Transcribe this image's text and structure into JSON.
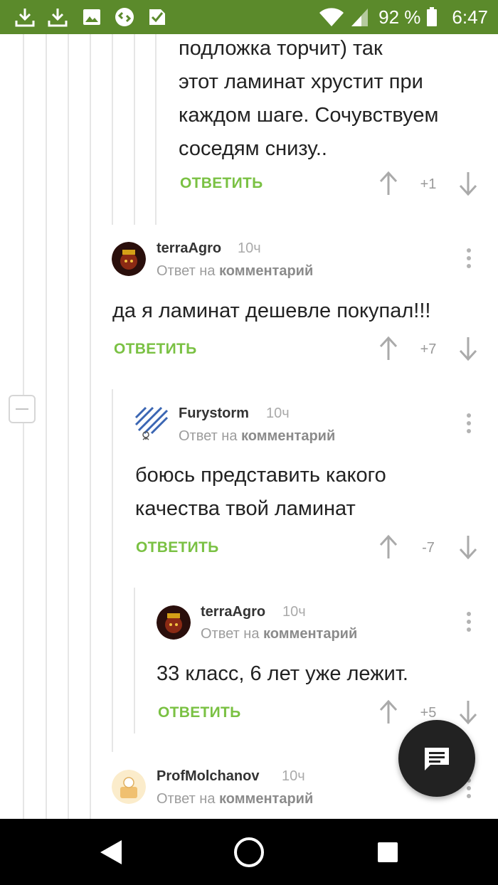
{
  "status_bar": {
    "battery": "92 %",
    "time": "6:47",
    "left_icons": [
      "download-icon",
      "download-icon",
      "image-icon",
      "shazam-icon",
      "check-app-icon"
    ],
    "right_icons": [
      "wifi-icon",
      "signal-icon",
      "battery-icon"
    ]
  },
  "colors": {
    "status_bar": "#5b8a2b",
    "reply": "#7ac143",
    "fab": "#222222"
  },
  "reply_label": "ОТВЕТИТЬ",
  "reply_to_prefix": "Ответ на",
  "reply_to_link": "комментарий",
  "comments": [
    {
      "text_lines": [
        "подложка торчит) так",
        "этот ламинат хрустит при",
        "каждом шаге. Сочувствуем",
        "соседям снизу.."
      ],
      "score": "+1"
    },
    {
      "author": "terraAgro",
      "time": "10ч",
      "text_lines": [
        "да я ламинат дешевле покупал!!!"
      ],
      "score": "+7"
    },
    {
      "author": "Furystorm",
      "time": "10ч",
      "text_lines": [
        "боюсь представить какого",
        "качества твой ламинат"
      ],
      "score": "-7"
    },
    {
      "author": "terraAgro",
      "time": "10ч",
      "text_lines": [
        "33 класс, 6 лет уже лежит."
      ],
      "score": "+5"
    },
    {
      "author": "ProfMolchanov",
      "time": "10ч"
    }
  ],
  "fab_icon": "comment-icon",
  "nav_icons": [
    "back-icon",
    "home-icon",
    "recents-icon"
  ]
}
